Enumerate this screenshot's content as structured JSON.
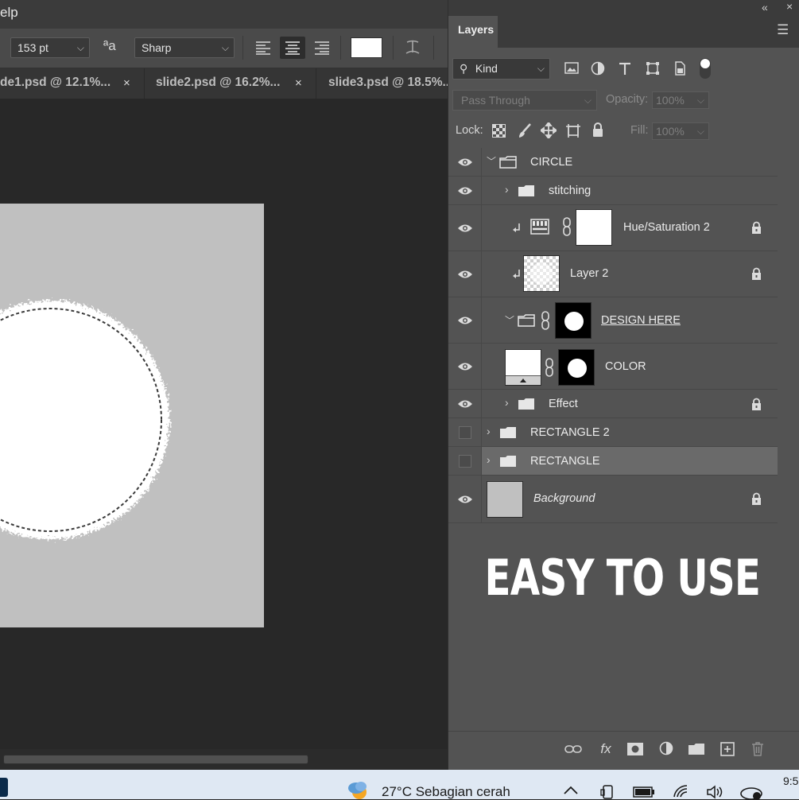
{
  "menubar": {
    "help_label": "elp"
  },
  "options": {
    "font_size": "153 pt",
    "aa_icon": "aA",
    "antialias": "Sharp",
    "align_left": "align-left-icon",
    "align_center": "align-center-icon",
    "align_right": "align-right-icon",
    "color_swatch": "#ffffff",
    "warp_icon": "warp-text-icon"
  },
  "tabs": [
    {
      "label": "de1.psd @ 12.1%...",
      "close": "×"
    },
    {
      "label": "slide2.psd @ 16.2%...",
      "close": "×"
    },
    {
      "label": "slide3.psd @ 18.5%..."
    }
  ],
  "layers_panel": {
    "collapse_icon": "«",
    "tab_label": "Layers",
    "menu_icon": "☰",
    "filter_kind": "Kind",
    "blend_mode": "Pass Through",
    "opacity_label": "Opacity:",
    "opacity_value": "100%",
    "lock_label": "Lock:",
    "fill_label": "Fill:",
    "fill_value": "100%",
    "layers": [
      {
        "name": "CIRCLE",
        "visible": true,
        "type": "group",
        "expanded": true,
        "indent": 0
      },
      {
        "name": "stitching",
        "visible": true,
        "type": "group",
        "expanded": false,
        "indent": 1
      },
      {
        "name": "Hue/Saturation 2",
        "visible": true,
        "type": "adjustment",
        "locked": true
      },
      {
        "name": "Layer 2",
        "visible": true,
        "type": "pixel",
        "locked": true
      },
      {
        "name": "DESIGN HERE ",
        "visible": true,
        "type": "masked-group"
      },
      {
        "name": "COLOR",
        "visible": true,
        "type": "fill-with-mask"
      },
      {
        "name": "Effect",
        "visible": true,
        "type": "group",
        "locked": true
      },
      {
        "name": "RECTANGLE 2",
        "visible": false,
        "type": "group"
      },
      {
        "name": "RECTANGLE",
        "visible": false,
        "type": "group",
        "selected": true
      },
      {
        "name": "Background",
        "visible": true,
        "type": "background",
        "locked": true
      }
    ],
    "promo": "EASY TO USE"
  },
  "taskbar": {
    "weather": "27°C  Sebagian cerah",
    "clock": "9:5"
  }
}
